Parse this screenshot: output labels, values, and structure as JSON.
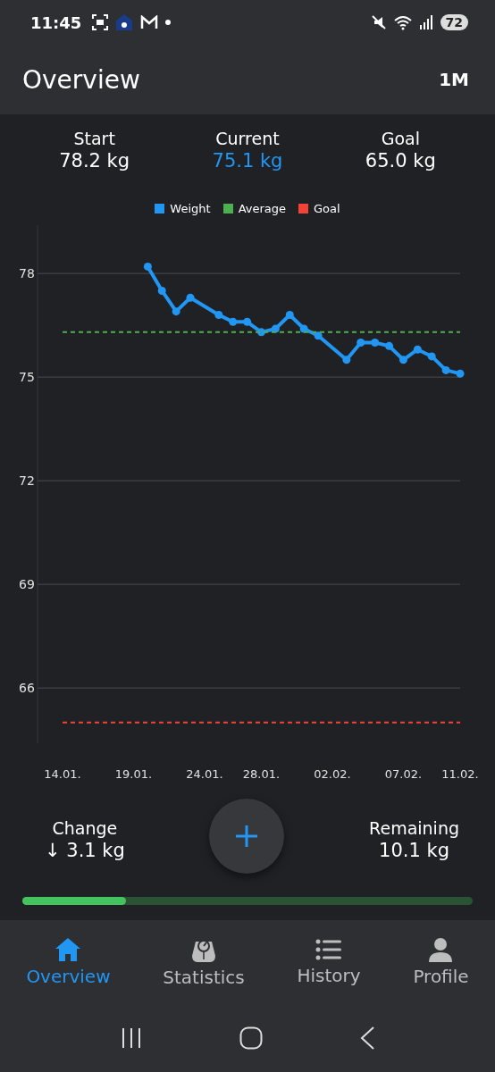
{
  "status_bar": {
    "time": "11:45",
    "battery": "72"
  },
  "app_bar": {
    "title": "Overview",
    "range": "1M"
  },
  "stats": [
    {
      "label": "Start",
      "value": "78.2 kg",
      "highlighted": false
    },
    {
      "label": "Current",
      "value": "75.1 kg",
      "highlighted": true
    },
    {
      "label": "Goal",
      "value": "65.0 kg",
      "highlighted": false
    }
  ],
  "chart_data": {
    "type": "line",
    "grid": true,
    "ylim": [
      64.4,
      79.4
    ],
    "yticks": [
      {
        "value": 78,
        "label": "78"
      },
      {
        "value": 75,
        "label": "75"
      },
      {
        "value": 72,
        "label": "72"
      },
      {
        "value": 69,
        "label": "69"
      },
      {
        "value": 66,
        "label": "66"
      }
    ],
    "categories": [
      "14.01.",
      null,
      null,
      null,
      null,
      "19.01.",
      null,
      null,
      null,
      null,
      "24.01.",
      null,
      null,
      null,
      "28.01.",
      null,
      null,
      null,
      null,
      "02.02.",
      null,
      null,
      null,
      null,
      "07.02.",
      null,
      null,
      null,
      "11.02."
    ],
    "series": [
      {
        "name": "Weight",
        "color": "#2196f3",
        "line_style": "solid",
        "marker": true,
        "values": [
          null,
          null,
          null,
          null,
          null,
          null,
          78.2,
          77.5,
          76.9,
          77.3,
          null,
          76.8,
          76.6,
          76.6,
          76.3,
          76.4,
          76.8,
          76.4,
          76.2,
          null,
          75.5,
          76.0,
          76.0,
          75.9,
          75.5,
          75.8,
          75.6,
          75.2,
          75.1
        ]
      },
      {
        "name": "Average",
        "color": "#4caf50",
        "line_style": "dashed",
        "marker": false,
        "values": [
          76.3,
          76.3,
          76.3,
          76.3,
          76.3,
          76.3,
          76.3,
          76.3,
          76.3,
          76.3,
          76.3,
          76.3,
          76.3,
          76.3,
          76.3,
          76.3,
          76.3,
          76.3,
          76.3,
          76.3,
          76.3,
          76.3,
          76.3,
          76.3,
          76.3,
          76.3,
          76.3,
          76.3,
          76.3
        ]
      },
      {
        "name": "Goal",
        "color": "#f44336",
        "line_style": "dashed",
        "marker": false,
        "values": [
          65.0,
          65.0,
          65.0,
          65.0,
          65.0,
          65.0,
          65.0,
          65.0,
          65.0,
          65.0,
          65.0,
          65.0,
          65.0,
          65.0,
          65.0,
          65.0,
          65.0,
          65.0,
          65.0,
          65.0,
          65.0,
          65.0,
          65.0,
          65.0,
          65.0,
          65.0,
          65.0,
          65.0,
          65.0
        ]
      }
    ]
  },
  "summary": [
    {
      "label": "Change",
      "value": "↓ 3.1 kg"
    },
    {
      "label": "Remaining",
      "value": "10.1 kg"
    }
  ],
  "progress": {
    "level": 0.23
  },
  "nav": [
    {
      "kind": "home",
      "label": "Overview",
      "selected": true
    },
    {
      "kind": "scale",
      "label": "Statistics",
      "selected": false
    },
    {
      "kind": "list",
      "label": "History",
      "selected": false
    },
    {
      "kind": "person",
      "label": "Profile",
      "selected": false
    }
  ]
}
